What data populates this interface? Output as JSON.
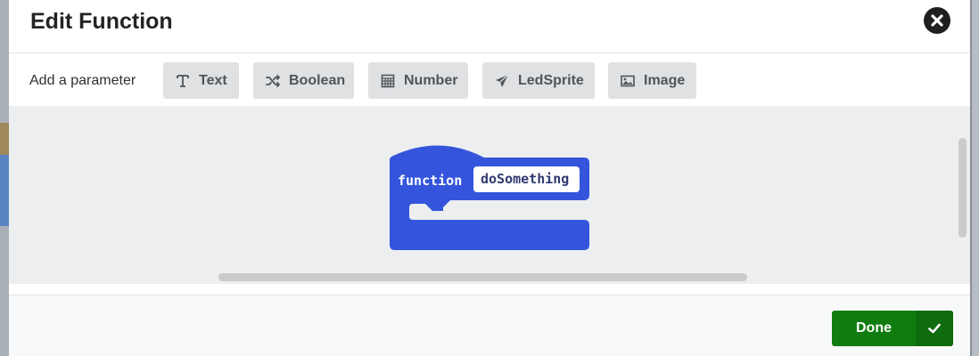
{
  "dialog": {
    "title": "Edit Function",
    "close_icon": "close-circle-icon"
  },
  "parameters": {
    "label": "Add a parameter",
    "types": [
      {
        "label": "Text",
        "icon": "text-icon"
      },
      {
        "label": "Boolean",
        "icon": "shuffle-icon"
      },
      {
        "label": "Number",
        "icon": "calculator-icon"
      },
      {
        "label": "LedSprite",
        "icon": "paper-plane-icon"
      },
      {
        "label": "Image",
        "icon": "image-icon"
      }
    ]
  },
  "block": {
    "keyword": "function",
    "name": "doSomething",
    "color": "#3455db"
  },
  "footer": {
    "done_label": "Done",
    "done_icon": "check-icon",
    "done_color": "#107c10"
  }
}
